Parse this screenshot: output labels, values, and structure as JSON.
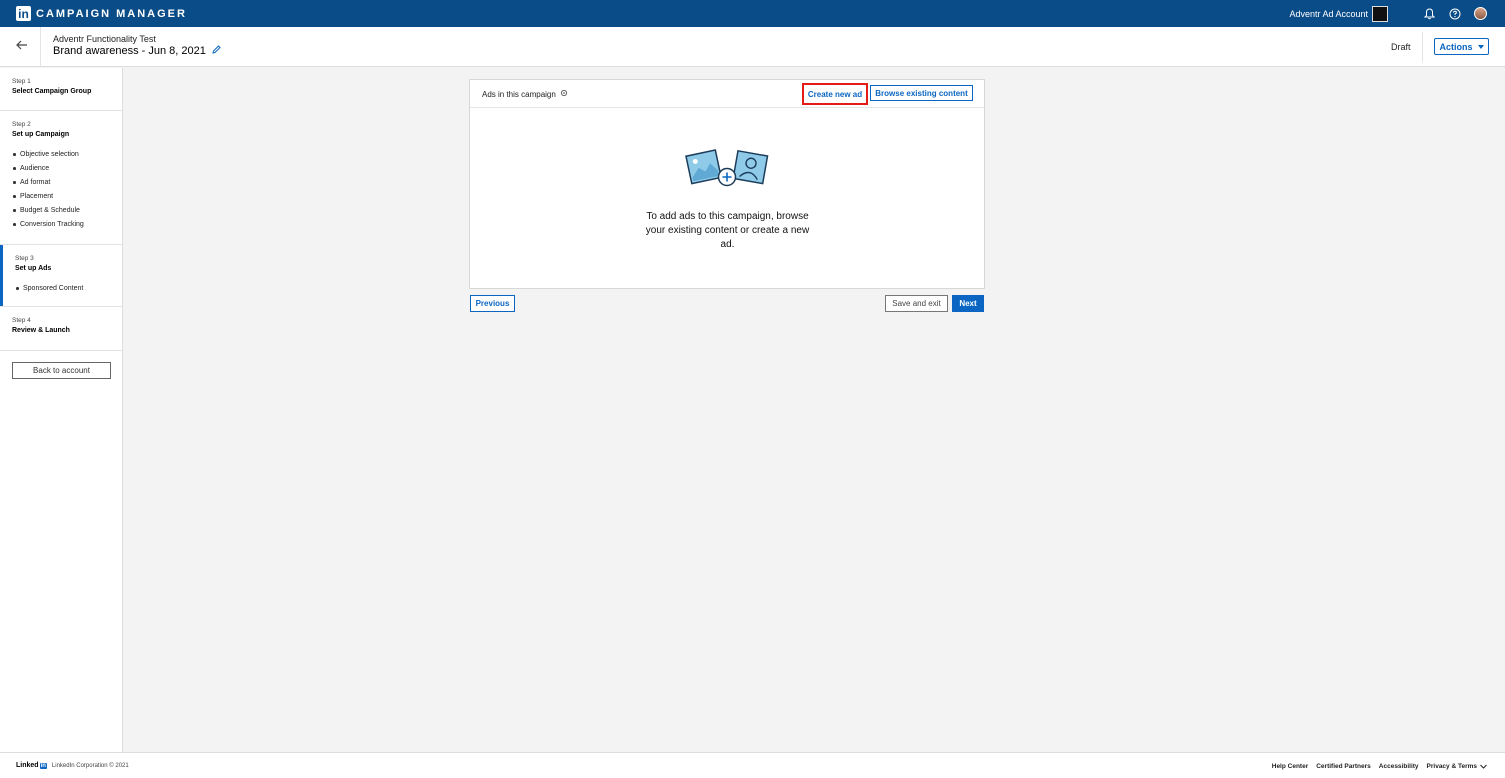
{
  "topbar": {
    "logo_text": "in",
    "brand": "CAMPAIGN MANAGER",
    "account_name": "Adventr Ad Account"
  },
  "header": {
    "campaign_group": "Adventr Functionality Test",
    "campaign_name": "Brand awareness - Jun 8, 2021",
    "status": "Draft",
    "actions_label": "Actions"
  },
  "sidebar": {
    "steps": [
      {
        "num": "Step 1",
        "title": "Select Campaign Group",
        "items": []
      },
      {
        "num": "Step 2",
        "title": "Set up Campaign",
        "items": [
          "Objective selection",
          "Audience",
          "Ad format",
          "Placement",
          "Budget & Schedule",
          "Conversion Tracking"
        ]
      },
      {
        "num": "Step 3",
        "title": "Set up Ads",
        "items": [
          "Sponsored Content"
        ]
      },
      {
        "num": "Step 4",
        "title": "Review & Launch",
        "items": []
      }
    ],
    "back_label": "Back to account"
  },
  "card": {
    "title": "Ads in this campaign",
    "create_label": "Create new ad",
    "browse_label": "Browse existing content",
    "empty_text": "To add ads to this campaign, browse your existing content or create a new ad."
  },
  "nav": {
    "previous": "Previous",
    "save_exit": "Save and exit",
    "next": "Next"
  },
  "footer": {
    "logo_text": "Linked",
    "logo_in": "in",
    "copyright": "LinkedIn Corporation © 2021",
    "links": [
      "Help Center",
      "Certified Partners",
      "Accessibility",
      "Privacy & Terms"
    ]
  },
  "colors": {
    "topbar": "#0a4c87",
    "accent": "#0a66c2",
    "highlight": "#e41b17"
  }
}
